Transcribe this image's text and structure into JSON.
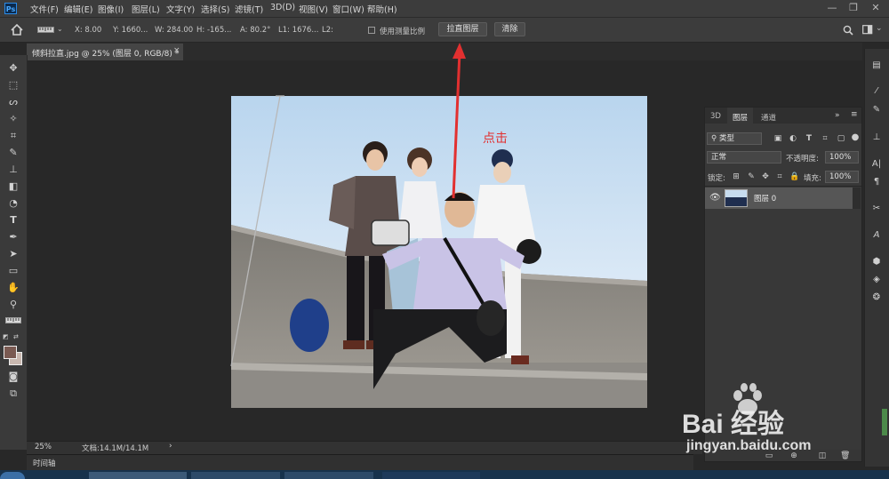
{
  "menubar": {
    "app_logo": "Ps",
    "items": [
      "文件(F)",
      "编辑(E)",
      "图像(I)",
      "图层(L)",
      "文字(Y)",
      "选择(S)",
      "滤镜(T)",
      "3D(D)",
      "视图(V)",
      "窗口(W)",
      "帮助(H)"
    ],
    "minimize": "—",
    "restore": "❐",
    "close": "✕"
  },
  "options": {
    "x": "X: 8.00",
    "y": "Y: 1660...",
    "w": "W: 284.00",
    "h": "H: -165...",
    "a": "A: 80.2°",
    "l1": "L1: 1676...",
    "l2": "L2:",
    "measure_scale_label": "使用测量比例",
    "straighten_button": "拉直图层",
    "clear_button": "清除"
  },
  "document": {
    "tab_title": "倾斜拉直.jpg @ 25% (图层 0, RGB/8) *",
    "tab_close": "×"
  },
  "annotation": {
    "click_label": "点击"
  },
  "status": {
    "zoom": "25%",
    "doc_info": "文档:14.1M/14.1M",
    "arrow": "›"
  },
  "timeline": {
    "label": "时间轴"
  },
  "layers_panel": {
    "tabs": [
      "3D",
      "图层",
      "通道"
    ],
    "filter_kind": "类型",
    "blend_mode": "正常",
    "opacity_label": "不透明度:",
    "opacity_value": "100%",
    "lock_label": "锁定:",
    "fill_label": "填充:",
    "fill_value": "100%",
    "layers": [
      {
        "name": "图层 0",
        "visible": true
      }
    ]
  },
  "watermark": {
    "brand": "Bai 经验",
    "url": "jingyan.baidu.com"
  },
  "colors": {
    "menubar_bg": "#3c3c3c",
    "canvas_bg": "#282828",
    "annotation_red": "#e23030",
    "selected_layer": "#565656"
  }
}
